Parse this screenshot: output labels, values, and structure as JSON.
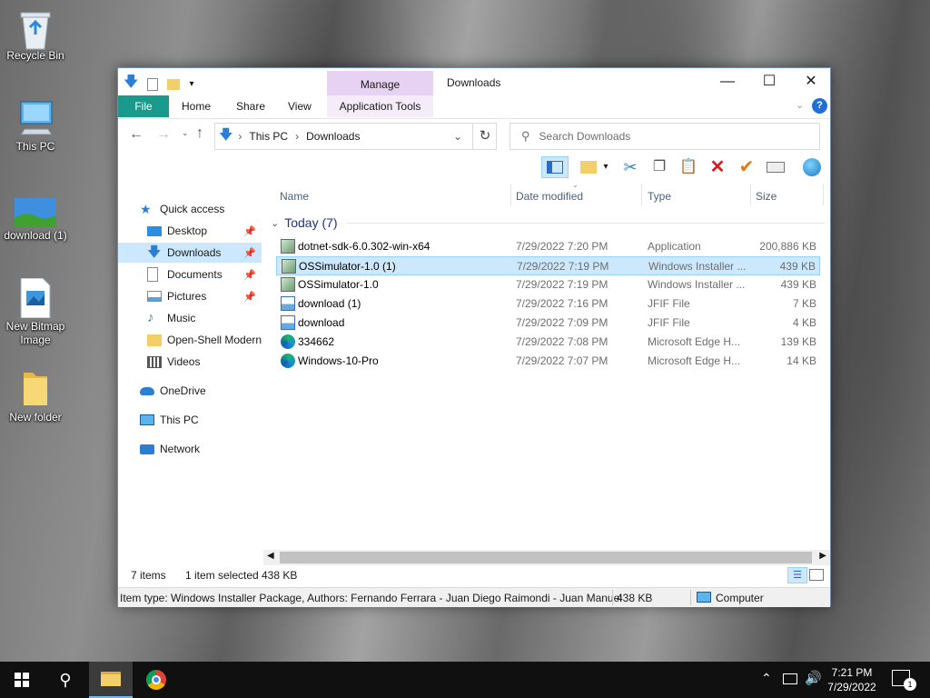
{
  "desktop": {
    "icons": [
      {
        "label": "Recycle Bin"
      },
      {
        "label": "This PC"
      },
      {
        "label": "download (1)"
      },
      {
        "label": "New Bitmap Image"
      },
      {
        "label": "New folder"
      }
    ]
  },
  "window": {
    "title": "Downloads",
    "contextual_tab_group": "Manage",
    "ribbon_tabs": [
      "File",
      "Home",
      "Share",
      "View",
      "Application Tools"
    ],
    "address": {
      "segments": [
        "This PC",
        "Downloads"
      ]
    },
    "search": {
      "placeholder": "Search Downloads"
    },
    "nav_pane": {
      "quick_access": "Quick access",
      "items": [
        {
          "label": "Desktop",
          "pinned": true
        },
        {
          "label": "Downloads",
          "pinned": true,
          "selected": true
        },
        {
          "label": "Documents",
          "pinned": true
        },
        {
          "label": "Pictures",
          "pinned": true
        },
        {
          "label": "Music",
          "pinned": false
        },
        {
          "label": "Open-Shell Modern",
          "pinned": false
        },
        {
          "label": "Videos",
          "pinned": false
        }
      ],
      "onedrive": "OneDrive",
      "this_pc": "This PC",
      "network": "Network"
    },
    "columns": {
      "name": "Name",
      "date": "Date modified",
      "type": "Type",
      "size": "Size"
    },
    "group": "Today (7)",
    "files": [
      {
        "name": "dotnet-sdk-6.0.302-win-x64",
        "date": "7/29/2022 7:20 PM",
        "type": "Application",
        "size": "200,886 KB",
        "icon": "installer-icon"
      },
      {
        "name": "OSSimulator-1.0 (1)",
        "date": "7/29/2022 7:19 PM",
        "type": "Windows Installer ...",
        "size": "439 KB",
        "icon": "installer-icon",
        "selected": true
      },
      {
        "name": "OSSimulator-1.0",
        "date": "7/29/2022 7:19 PM",
        "type": "Windows Installer ...",
        "size": "439 KB",
        "icon": "installer-icon"
      },
      {
        "name": "download (1)",
        "date": "7/29/2022 7:16 PM",
        "type": "JFIF File",
        "size": "7 KB",
        "icon": "image-file-icon"
      },
      {
        "name": "download",
        "date": "7/29/2022 7:09 PM",
        "type": "JFIF File",
        "size": "4 KB",
        "icon": "image-file-icon"
      },
      {
        "name": "334662",
        "date": "7/29/2022 7:08 PM",
        "type": "Microsoft Edge H...",
        "size": "139 KB",
        "icon": "edge-icon"
      },
      {
        "name": "Windows-10-Pro",
        "date": "7/29/2022 7:07 PM",
        "type": "Microsoft Edge H...",
        "size": "14 KB",
        "icon": "edge-icon"
      }
    ],
    "status": {
      "items": "7 items",
      "selected": "1 item selected",
      "size": "438 KB"
    },
    "details": {
      "text": "Item type: Windows Installer Package, Authors: Fernando Ferrara - Juan Diego Raimondi - Juan Manuel",
      "size": "438 KB",
      "location": "Computer"
    }
  },
  "taskbar": {
    "time": "7:21 PM",
    "date": "7/29/2022",
    "notification_count": "1"
  },
  "colors": {
    "file_tab": "#1a9a8d",
    "manage_tab": "#e8d2f3",
    "selection": "#cce8ff",
    "taskbar": "#101010"
  }
}
